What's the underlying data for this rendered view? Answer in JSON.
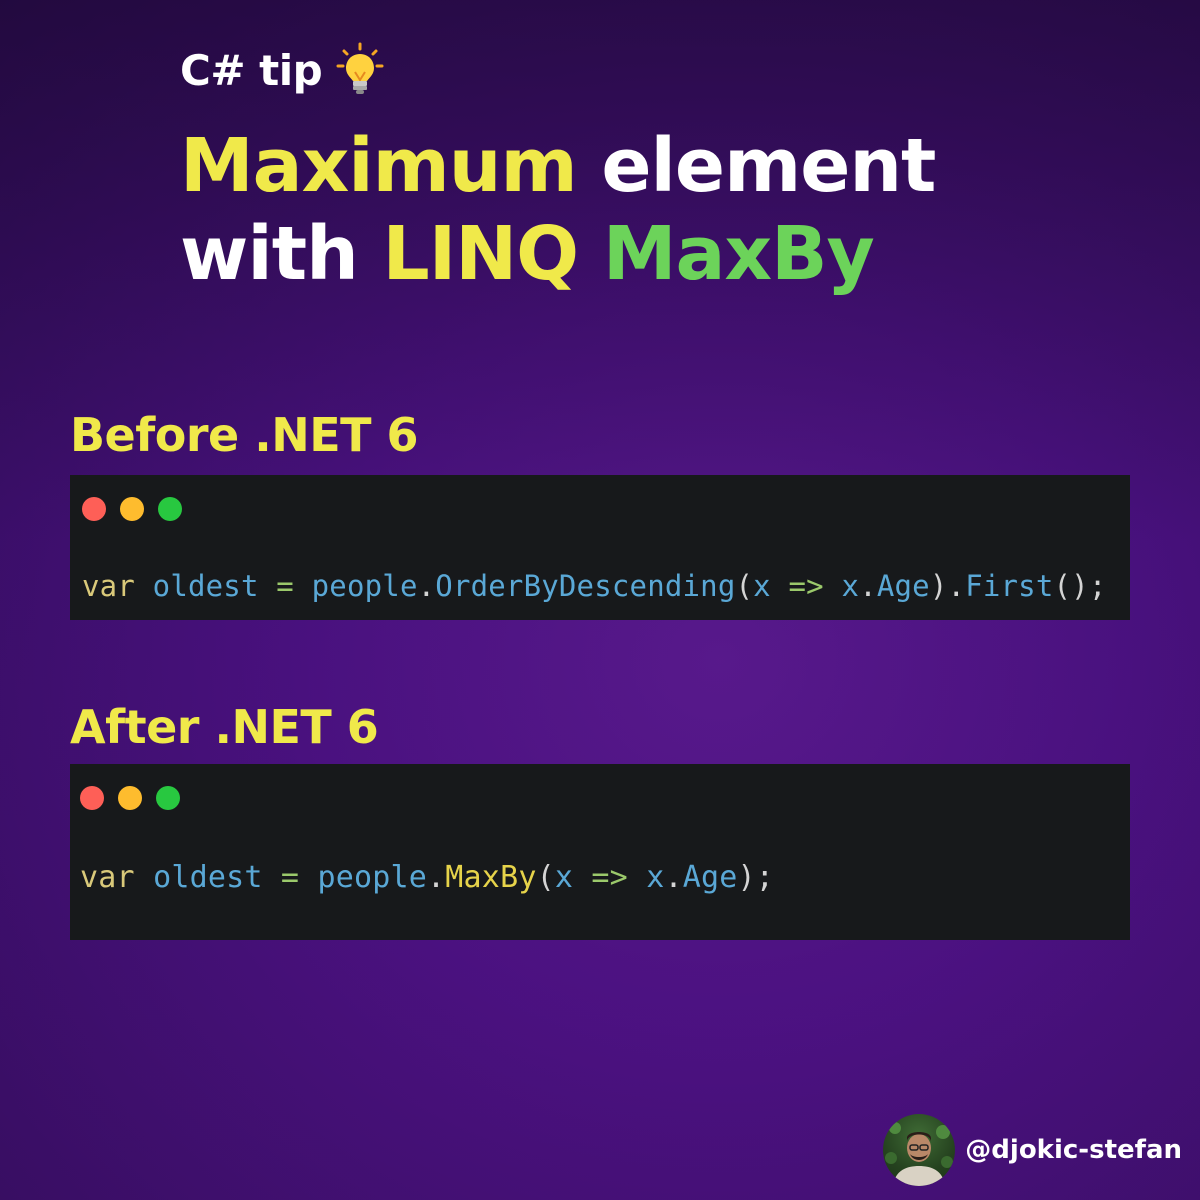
{
  "header": {
    "tip_label": "C# tip",
    "tip_icon": "lightbulb-icon",
    "headline": {
      "part1": "Maximum",
      "part2": " element",
      "part3": "with ",
      "part4": "LINQ",
      "part5": " MaxBy"
    }
  },
  "colors": {
    "yellow": "#f0e94a",
    "green": "#6cd35a",
    "code_bg": "#17191b",
    "dot_red": "#fe5f57",
    "dot_yellow": "#febc2e",
    "dot_green": "#28c840"
  },
  "before": {
    "title": "Before .NET 6",
    "code": {
      "kw": "var",
      "var_name": "oldest",
      "assign": "=",
      "obj": "people",
      "dot1": ".",
      "method": "OrderByDescending",
      "paren_open": "(",
      "param": "x",
      "arrow": "=>",
      "param2": "x",
      "dot2": ".",
      "prop": "Age",
      "paren_close": ")",
      "dot3": ".",
      "method2": "First",
      "tail": "();"
    }
  },
  "after": {
    "title": "After .NET 6",
    "code": {
      "kw": "var",
      "var_name": "oldest",
      "assign": "=",
      "obj": "people",
      "dot1": ".",
      "method": "MaxBy",
      "paren_open": "(",
      "param": "x",
      "arrow": "=>",
      "param2": "x",
      "dot2": ".",
      "prop": "Age",
      "tail": ");"
    }
  },
  "author": {
    "handle": "@djokic-stefan",
    "avatar_icon": "avatar"
  }
}
